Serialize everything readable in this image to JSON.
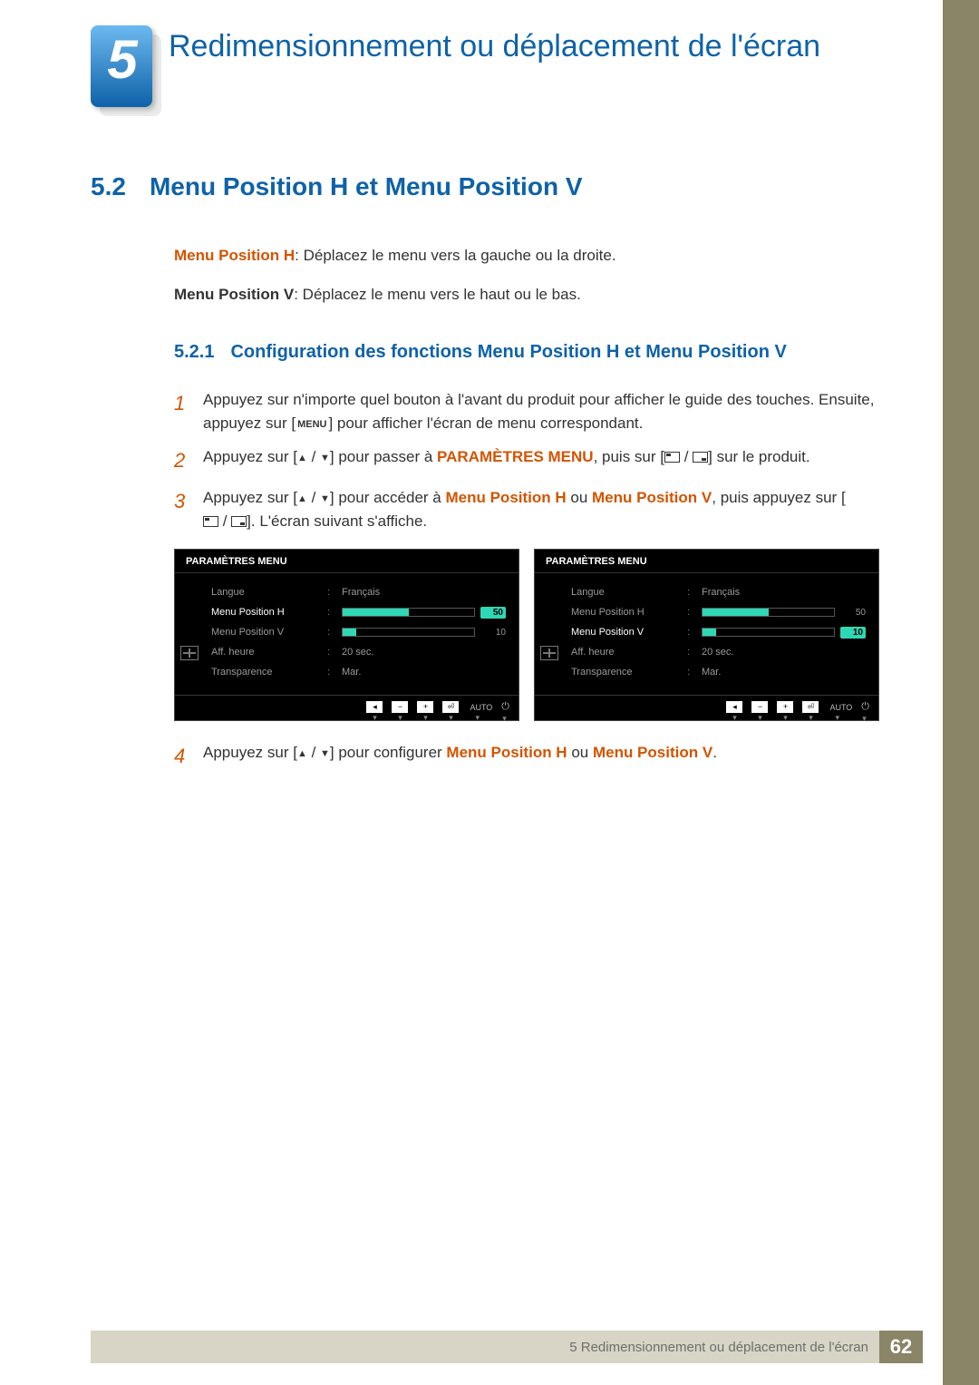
{
  "chapter": {
    "number": "5",
    "title": "Redimensionnement ou déplacement de l'écran"
  },
  "section": {
    "number": "5.2",
    "title": "Menu Position H et Menu Position V"
  },
  "definitions": {
    "h_label": "Menu Position H",
    "h_text": ": Déplacez le menu vers la gauche ou la droite.",
    "v_label": "Menu Position V",
    "v_text": ": Déplacez le menu vers le haut ou le bas."
  },
  "subsection": {
    "number": "5.2.1",
    "title": "Configuration des fonctions Menu Position H et Menu Position V"
  },
  "steps": {
    "s1": "Appuyez sur n'importe quel bouton à l'avant du produit pour afficher le guide des touches. Ensuite, appuyez sur [",
    "s1b": "] pour afficher l'écran de menu correspondant.",
    "menu_icon": "MENU",
    "s2a": "Appuyez sur [",
    "s2b": "] pour passer à ",
    "s2_target": "PARAMÈTRES MENU",
    "s2c": ", puis sur [",
    "s2d": "] sur le produit.",
    "s3a": "Appuyez sur [",
    "s3b": "] pour accéder à ",
    "s3_h": "Menu Position H",
    "s3_or": " ou ",
    "s3_v": "Menu Position V",
    "s3c": ", puis appuyez sur [",
    "s3d": "]. L'écran suivant s'affiche.",
    "s4a": "Appuyez sur [",
    "s4b": "] pour configurer ",
    "s4_h": "Menu Position H",
    "s4_or": " ou ",
    "s4_v": "Menu Position V",
    "s4c": "."
  },
  "osd": {
    "title": "PARAMÈTRES MENU",
    "rows": {
      "langue": {
        "label": "Langue",
        "value": "Français"
      },
      "posh": {
        "label": "Menu Position H",
        "value": "50",
        "fill": 50
      },
      "posv": {
        "label": "Menu Position V",
        "value": "10",
        "fill": 10
      },
      "aff": {
        "label": "Aff. heure",
        "value": "20 sec."
      },
      "transp": {
        "label": "Transparence",
        "value": "Mar."
      }
    },
    "footer": {
      "auto": "AUTO"
    }
  },
  "footer": {
    "text": "5 Redimensionnement ou déplacement de l'écran",
    "page": "62"
  }
}
